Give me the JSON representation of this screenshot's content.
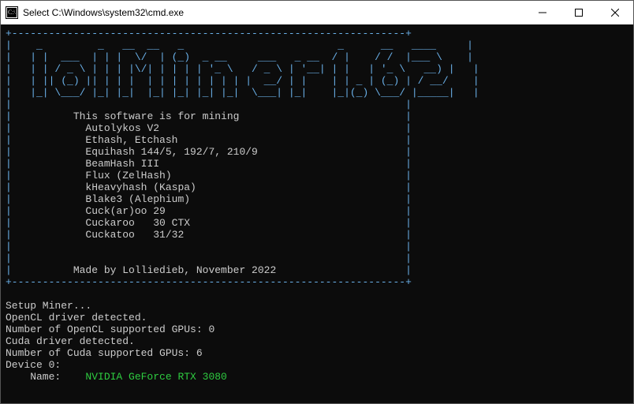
{
  "window": {
    "title": "Select C:\\Windows\\system32\\cmd.exe"
  },
  "box": {
    "top": "+----------------------------------------------------------------+",
    "bottom": "+----------------------------------------------------------------+",
    "ascii": [
      "|    _         _   __  __   _                         _      __   ____     |",
      "|   | |  ___  | | |  \\/  | (_)  _ __     ___   _ __  / |    / /  |___ \\    |",
      "|   | | / _ \\ | | | |\\/| | | | | '_ \\   / _ \\ | '__| | |   | '_ \\   __) |   |",
      "|   | || (_) || | | |  | | | | | | | | |  __/ | |    | | _ | (_) | / __/    |",
      "|   |_| \\___/ |_| |_|  |_| |_| |_| |_|  \\___| |_|    |_|(_) \\___/ |_____|   |"
    ],
    "blank": "|                                                                |",
    "intro": "|          This software is for mining                           |",
    "algos": [
      "|            Autolykos V2                                        |",
      "|            Ethash, Etchash                                     |",
      "|            Equihash 144/5, 192/7, 210/9                        |",
      "|            BeamHash III                                        |",
      "|            Flux (ZelHash)                                      |",
      "|            kHeavyhash (Kaspa)                                  |",
      "|            Blake3 (Alephium)                                   |",
      "|            Cuck(ar)oo 29                                       |",
      "|            Cuckaroo   30 CTX                                   |",
      "|            Cuckatoo   31/32                                    |"
    ],
    "credit": "|          Made by Lolliedieb, November 2022                     |"
  },
  "status": {
    "setup": "Setup Miner...",
    "opencl_detected": "OpenCL driver detected.",
    "opencl_gpus": "Number of OpenCL supported GPUs: 0",
    "cuda_detected": "Cuda driver detected.",
    "cuda_gpus": "Number of Cuda supported GPUs: 6",
    "device_header": "Device 0:",
    "name_label": "    Name:    ",
    "gpu_name": "NVIDIA GeForce RTX 3080"
  }
}
